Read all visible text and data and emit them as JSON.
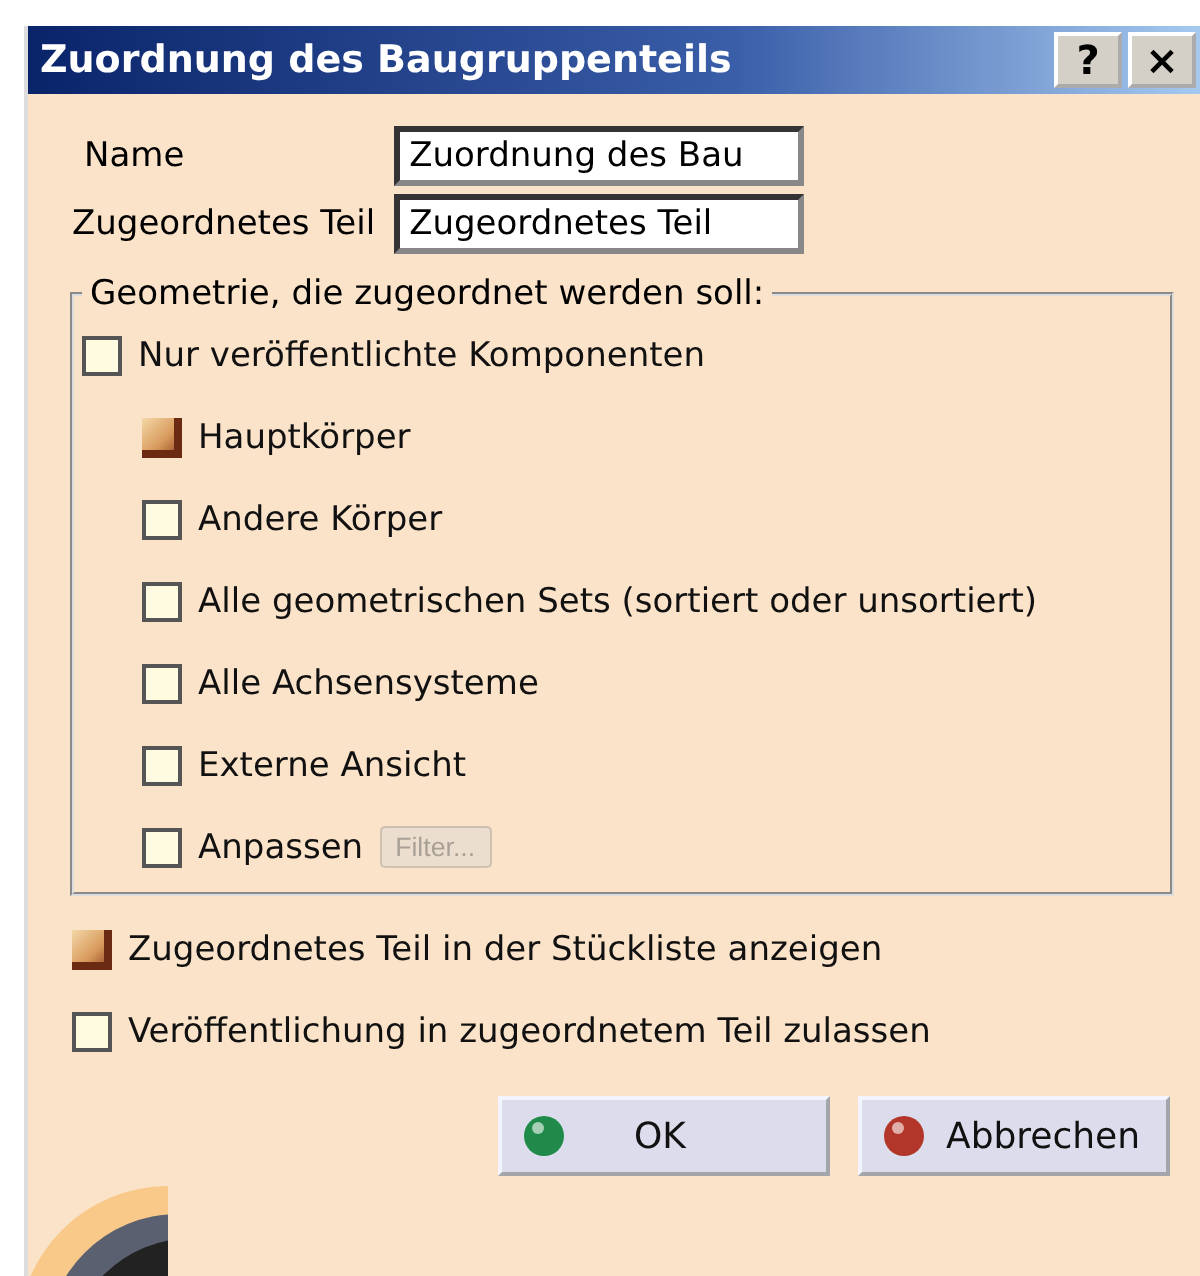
{
  "window": {
    "title": "Zuordnung des Baugruppenteils",
    "help_button": "?",
    "close_button": "×"
  },
  "fields": [
    {
      "label": "Name",
      "value": "Zuordnung des Bau"
    },
    {
      "label": "Zugeordnetes Teil",
      "value": "Zugeordnetes Teil"
    }
  ],
  "geometry_group": {
    "title": "Geometrie, die zugeordnet werden soll:",
    "published_only": {
      "label": "Nur veröffentlichte Komponenten",
      "checked": false
    },
    "options": [
      {
        "label": "Hauptkörper",
        "checked": true
      },
      {
        "label": "Andere Körper",
        "checked": false
      },
      {
        "label": "Alle geometrischen Sets (sortiert oder unsortiert)",
        "checked": false
      },
      {
        "label": "Alle Achsensysteme",
        "checked": false
      },
      {
        "label": "Externe Ansicht",
        "checked": false
      }
    ],
    "customize": {
      "label": "Anpassen",
      "checked": false,
      "filter_button": {
        "label": "Filter...",
        "disabled": true
      }
    }
  },
  "options": [
    {
      "label": "Zugeordnetes Teil in der Stückliste anzeigen",
      "checked": true
    },
    {
      "label": "Veröffentlichung in zugeordnetem Teil zulassen",
      "checked": false
    }
  ],
  "buttons": [
    {
      "label": "OK",
      "kind": "ok"
    },
    {
      "label": "Abbrechen",
      "kind": "cancel"
    }
  ]
}
